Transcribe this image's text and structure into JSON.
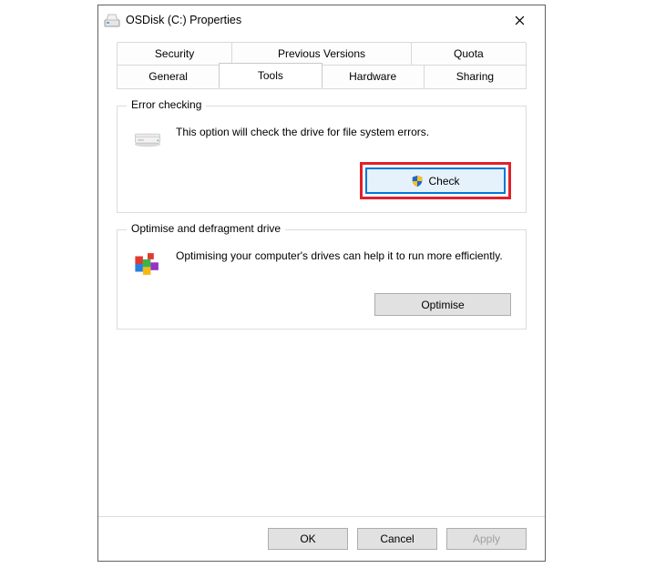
{
  "titlebar": {
    "title": "OSDisk (C:) Properties"
  },
  "tabs": {
    "row1": [
      "Security",
      "Previous Versions",
      "Quota"
    ],
    "row2": [
      "General",
      "Tools",
      "Hardware",
      "Sharing"
    ],
    "active": "Tools"
  },
  "groups": {
    "error_checking": {
      "legend": "Error checking",
      "description": "This option will check the drive for file system errors.",
      "button": "Check"
    },
    "optimise": {
      "legend": "Optimise and defragment drive",
      "description": "Optimising your computer's drives can help it to run more efficiently.",
      "button": "Optimise"
    }
  },
  "buttons": {
    "ok": "OK",
    "cancel": "Cancel",
    "apply": "Apply"
  },
  "colors": {
    "highlight": "#e2202a",
    "focus_border": "#0178d7",
    "focus_fill": "#e5f1fb",
    "button_fill": "#e1e1e1",
    "button_border": "#adadad"
  }
}
